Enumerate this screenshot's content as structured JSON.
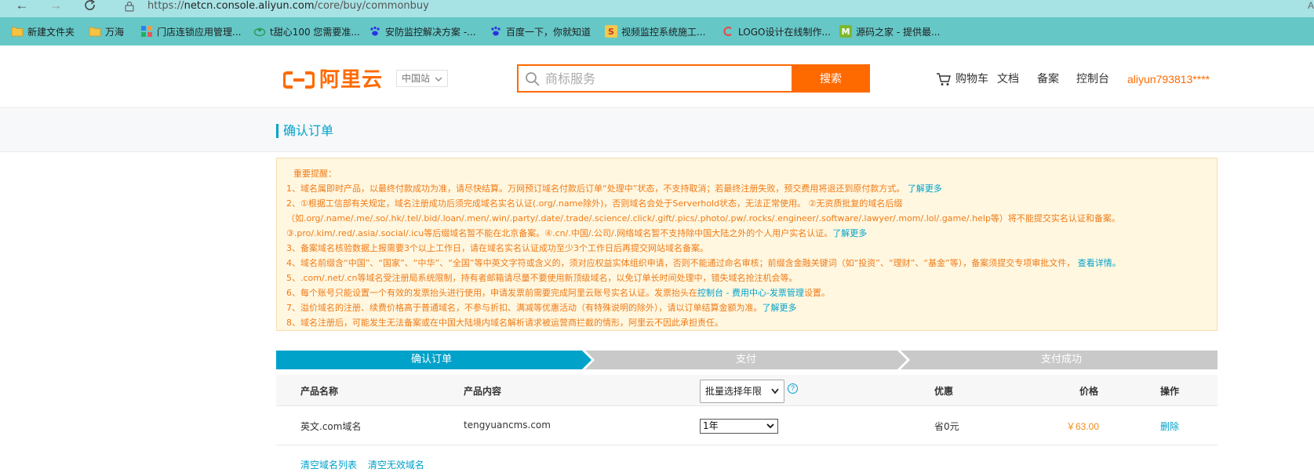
{
  "browser": {
    "url_scheme": "https://",
    "url_host": "netcn.console.aliyun.com",
    "url_path": "/core/buy/commonbuy",
    "right_glyph": "A",
    "bookmarks": [
      {
        "label": "新建文件夹",
        "icon": "folder-icon"
      },
      {
        "label": "万海",
        "icon": "folder-icon"
      },
      {
        "label": "门店连锁应用管理...",
        "icon": "grid-icon"
      },
      {
        "label": "t甜心100 您需要准...",
        "icon": "leaf-icon"
      },
      {
        "label": "安防监控解决方案 -...",
        "icon": "paw-icon"
      },
      {
        "label": "百度一下，你就知道",
        "icon": "paw-icon"
      },
      {
        "label": "视频监控系统施工...",
        "icon": "s-logo-icon"
      },
      {
        "label": "LOGO设计在线制作...",
        "icon": "c-logo-icon"
      },
      {
        "label": "源码之家 - 提供最...",
        "icon": "m-logo-icon"
      }
    ]
  },
  "header": {
    "logo_text": "阿里云",
    "region": "中国站",
    "search_placeholder": "商标服务",
    "search_button": "搜索",
    "nav": {
      "cart": "购物车",
      "docs": "文档",
      "beian": "备案",
      "console": "控制台",
      "user": "aliyun793813****"
    }
  },
  "page": {
    "title": "确认订单"
  },
  "notice": {
    "heading": "重要提醒：",
    "line1": "1、域名属即时产品，以最终付款成功为准，请尽快结算。万网预订域名付款后订单“处理中”状态，不支持取消；若最终注册失败，预交费用将退还到原付款方式。",
    "line1_link": "了解更多",
    "line2_part1": "2、①根据工信部有关规定，域名注册成功后须完成域名实名认证(.org/.name除外)，否则域名会处于Serverhold状态，无法正常使用。 ②无资质批复的域名后缀（如.org/.name/.me/.so/.hk/.tel/.bid/.loan/.men/.win/.party/.date/.trade/.science/.click/.gift/.pics/.photo/.pw/.rocks/.engineer/.software/.lawyer/.mom/.lol/.game/.help等）将不能提交实名认证和备案。③.pro/.kim/.red/.asia/.social/.icu等后缀域名暂不能在北京备案。④.cn/.中国/.公司/.网络域名暂不支持除中国大陆之外的个人用户实名认证。",
    "line2_link": "了解更多",
    "line3": "3、备案域名核验数据上报需要3个以上工作日，请在域名实名认证成功至少3个工作日后再提交网站域名备案。",
    "line4": "4、域名前缀含“中国”、“国家”、“中华”、“全国”等中英文字符或含义的，须对应权益实体组织申请，否则不能通过命名审核；前缀含金融关键词（如“投资”、“理财”、“基金”等），备案须提交专项审批文件，",
    "line4_link": "查看详情。",
    "line5": "5、.com/.net/.cn等域名受注册局系统限制，持有者邮箱请尽量不要使用新顶级域名，以免订单长时间处理中，错失域名抢注机会等。",
    "line6_part1": "6、每个账号只能设置一个有效的发票抬头进行使用，申请发票前需要完成阿里云账号实名认证。发票抬头在",
    "line6_link": "控制台 - 费用中心-发票管理",
    "line6_part2": "设置。",
    "line7": "7、溢价域名的注册、续费价格高于普通域名，不参与折扣、满减等优惠活动（有特殊说明的除外），请以订单结算金额为准。",
    "line7_link": "了解更多",
    "line8": "8、域名注册后，可能发生无法备案或在中国大陆境内域名解析请求被运营商拦截的情形，阿里云不因此承担责任。"
  },
  "steps": {
    "step1": "确认订单",
    "step2": "支付",
    "step3": "支付成功",
    "active_color": "#00a2ca",
    "inactive_color": "#c9c9c9"
  },
  "table": {
    "headers": {
      "name": "产品名称",
      "content": "产品内容",
      "years_select": "批量选择年限",
      "discount": "优惠",
      "price": "价格",
      "action": "操作"
    },
    "rows": [
      {
        "name": "英文.com域名",
        "content": "tengyuancms.com",
        "year": "1年",
        "discount": "省0元",
        "price": "￥63.00",
        "action": "删除"
      }
    ]
  },
  "footer": {
    "clear_list": "清空域名列表",
    "clear_invalid": "清空无效域名"
  }
}
